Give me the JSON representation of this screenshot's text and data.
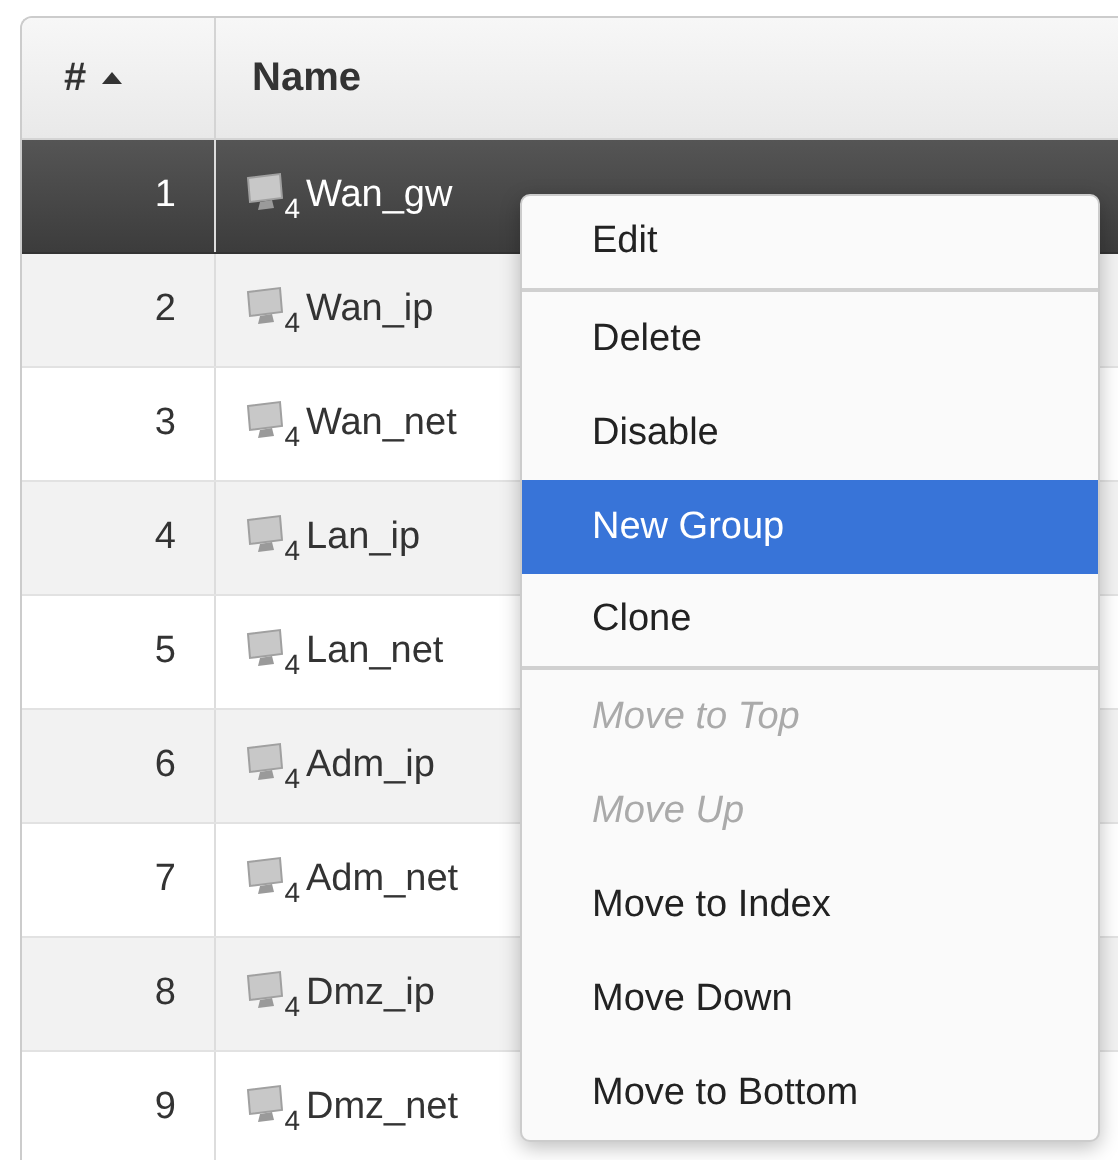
{
  "table": {
    "columns": [
      {
        "label": "#",
        "sorted": true
      },
      {
        "label": "Name",
        "sorted": false
      }
    ],
    "rows": [
      {
        "index": "1",
        "name": "Wan_gw",
        "badge": "4",
        "selected": true
      },
      {
        "index": "2",
        "name": "Wan_ip",
        "badge": "4",
        "selected": false
      },
      {
        "index": "3",
        "name": "Wan_net",
        "badge": "4",
        "selected": false
      },
      {
        "index": "4",
        "name": "Lan_ip",
        "badge": "4",
        "selected": false
      },
      {
        "index": "5",
        "name": "Lan_net",
        "badge": "4",
        "selected": false
      },
      {
        "index": "6",
        "name": "Adm_ip",
        "badge": "4",
        "selected": false
      },
      {
        "index": "7",
        "name": "Adm_net",
        "badge": "4",
        "selected": false
      },
      {
        "index": "8",
        "name": "Dmz_ip",
        "badge": "4",
        "selected": false
      },
      {
        "index": "9",
        "name": "Dmz_net",
        "badge": "4",
        "selected": false
      }
    ]
  },
  "context_menu": {
    "items": [
      {
        "label": "Edit",
        "selected": false,
        "disabled": false,
        "divider_after": true
      },
      {
        "label": "Delete",
        "selected": false,
        "disabled": false,
        "divider_after": false
      },
      {
        "label": "Disable",
        "selected": false,
        "disabled": false,
        "divider_after": false
      },
      {
        "label": "New Group",
        "selected": true,
        "disabled": false,
        "divider_after": false
      },
      {
        "label": "Clone",
        "selected": false,
        "disabled": false,
        "divider_after": true
      },
      {
        "label": "Move to Top",
        "selected": false,
        "disabled": true,
        "divider_after": false
      },
      {
        "label": "Move Up",
        "selected": false,
        "disabled": true,
        "divider_after": false
      },
      {
        "label": "Move to Index",
        "selected": false,
        "disabled": false,
        "divider_after": false
      },
      {
        "label": "Move Down",
        "selected": false,
        "disabled": false,
        "divider_after": false
      },
      {
        "label": "Move to Bottom",
        "selected": false,
        "disabled": false,
        "divider_after": false
      }
    ]
  }
}
